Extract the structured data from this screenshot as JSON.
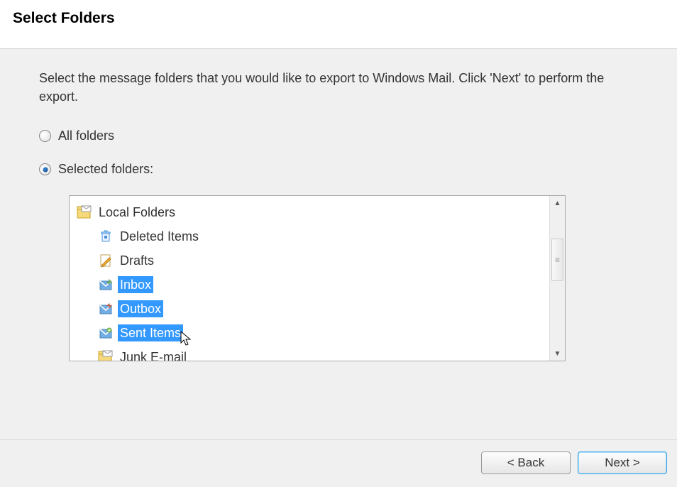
{
  "header": {
    "title": "Select Folders"
  },
  "content": {
    "instruction": "Select the message folders that you would like to export to Windows Mail. Click 'Next' to perform the export.",
    "radio_all": "All folders",
    "radio_selected": "Selected folders:"
  },
  "tree": {
    "root": "Local Folders",
    "items": [
      {
        "label": "Deleted Items",
        "icon": "trash",
        "selected": false
      },
      {
        "label": "Drafts",
        "icon": "draft",
        "selected": false
      },
      {
        "label": "Inbox",
        "icon": "inbox",
        "selected": true
      },
      {
        "label": "Outbox",
        "icon": "outbox",
        "selected": true
      },
      {
        "label": "Sent Items",
        "icon": "sent",
        "selected": true
      },
      {
        "label": "Junk E-mail",
        "icon": "junk",
        "selected": false
      }
    ]
  },
  "footer": {
    "back": "< Back",
    "next": "Next >"
  }
}
